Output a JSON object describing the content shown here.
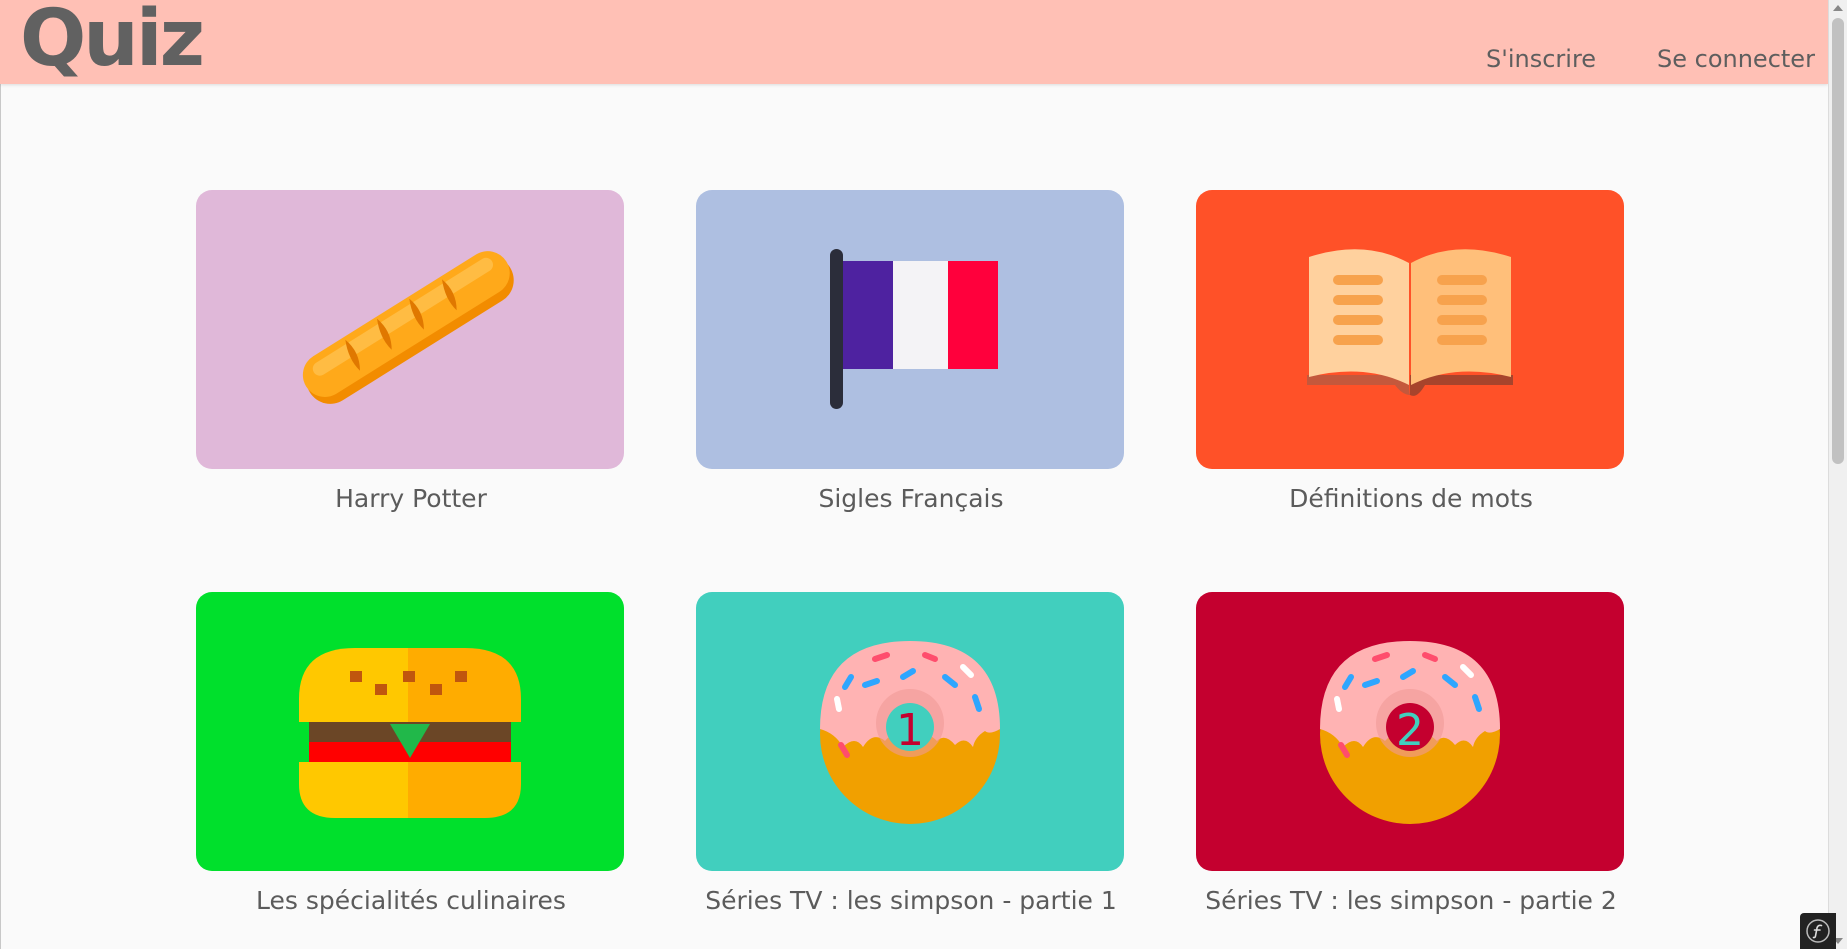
{
  "header": {
    "logo": "Quiz",
    "nav": {
      "register": "S'inscrire",
      "login": "Se connecter"
    },
    "background": "#ffc0b5"
  },
  "quizzes": [
    {
      "title": "Harry Potter",
      "color": "#e0b8d9",
      "icon": "baguette-icon"
    },
    {
      "title": "Sigles Français",
      "color": "#aebfe1",
      "icon": "french-flag-icon"
    },
    {
      "title": "Définitions de mots",
      "color": "#ff5128",
      "icon": "open-book-icon"
    },
    {
      "title": "Les spécialités culinaires",
      "color": "#00e02c",
      "icon": "burger-icon"
    },
    {
      "title": "Séries TV : les simpson - partie 1",
      "color": "#41cfbe",
      "icon": "donut-1-icon",
      "badge": "1"
    },
    {
      "title": "Séries TV : les simpson - partie 2",
      "color": "#c4002f",
      "icon": "donut-2-icon",
      "badge": "2"
    }
  ],
  "toolbar": {
    "icon": "symfony-logo-icon"
  }
}
